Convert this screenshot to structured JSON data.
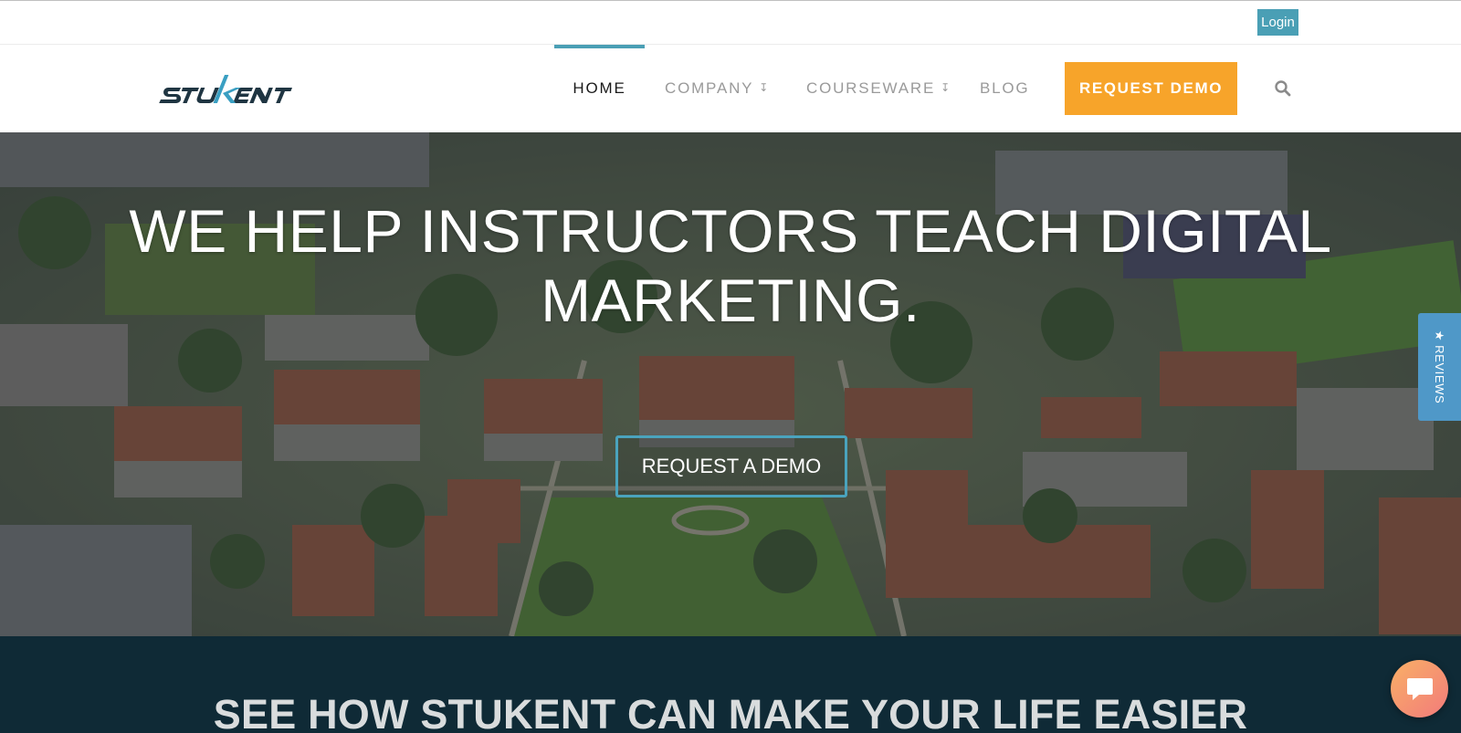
{
  "topbar": {
    "login_label": "Login"
  },
  "brand": {
    "logo_text": "STUKENT",
    "accent": "#4a9fb5"
  },
  "nav": {
    "items": [
      {
        "label": "HOME",
        "active": true,
        "has_dropdown": false
      },
      {
        "label": "COMPANY",
        "active": false,
        "has_dropdown": true
      },
      {
        "label": "COURSEWARE",
        "active": false,
        "has_dropdown": true
      },
      {
        "label": "BLOG",
        "active": false,
        "has_dropdown": false
      }
    ],
    "cta_label": "REQUEST DEMO",
    "cta_color": "#f7a42a",
    "search_icon": "search-icon"
  },
  "hero": {
    "title": "WE HELP INSTRUCTORS TEACH DIGITAL MARKETING.",
    "cta_label": "REQUEST A DEMO",
    "cta_border_color": "#4aa3bd"
  },
  "reviews_tab": {
    "label": "★ REVIEWS",
    "color": "#4f98c8"
  },
  "section": {
    "title": "SEE HOW STUKENT CAN MAKE YOUR LIFE EASIER",
    "background": "#0f2a36"
  },
  "chat": {
    "icon": "chat-bubble-icon"
  }
}
